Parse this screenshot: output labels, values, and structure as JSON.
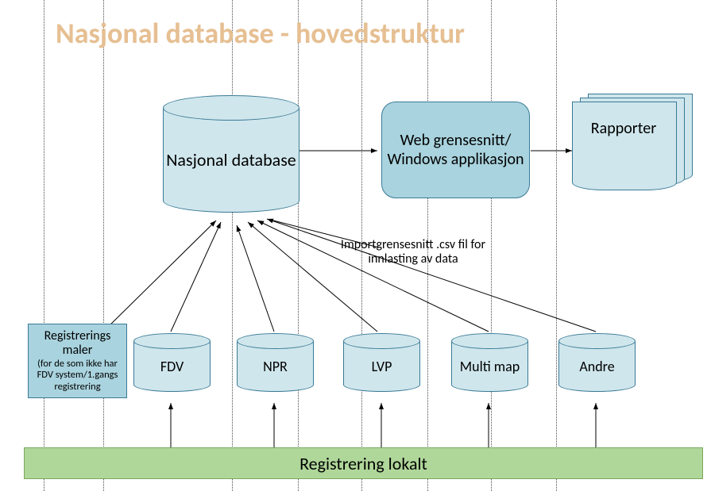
{
  "title": "Nasjonal database - hovedstruktur",
  "main_db_label": "Nasjonal database",
  "web_box_label": "Web grensesnitt/ Windows applikasjon",
  "reports_label": "Rapporter",
  "import_annotation": "Importgrensesnitt .csv fil for innlasting av data",
  "maler": {
    "title": "Registrerings maler",
    "sub": "(for de som ikke har FDV system/1.gangs registrering"
  },
  "sources": [
    {
      "label": "FDV"
    },
    {
      "label": "NPR"
    },
    {
      "label": "LVP"
    },
    {
      "label": "Multi map"
    },
    {
      "label": "Andre"
    }
  ],
  "bottom_bar_label": "Registrering lokalt"
}
